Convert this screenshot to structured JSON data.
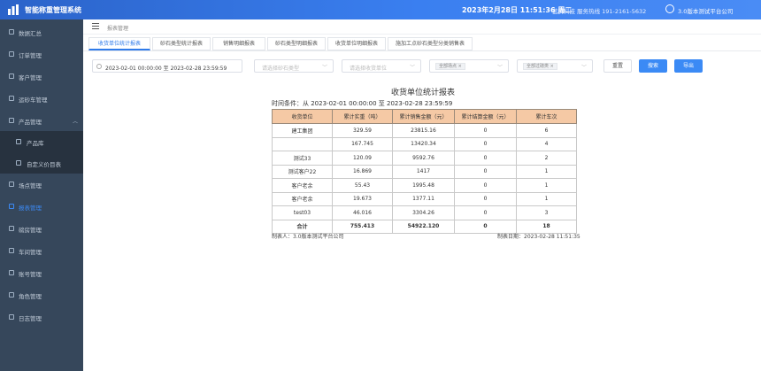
{
  "header": {
    "app_title": "智能称重管理系统",
    "datetime": "2023年2月28日 11:51:36 周二",
    "company_info": "蓝狮科技 服务热线 191-2161-5632",
    "user_label": "3.0版本测试平台公司"
  },
  "sidebar": {
    "items": [
      {
        "label": "数据汇总"
      },
      {
        "label": "订单管理"
      },
      {
        "label": "客户管理"
      },
      {
        "label": "运砂车管理"
      },
      {
        "label": "产品管理"
      },
      {
        "label": "产品库"
      },
      {
        "label": "自定义价目表"
      },
      {
        "label": "场点管理"
      },
      {
        "label": "报表管理"
      },
      {
        "label": "磅房管理"
      },
      {
        "label": "车间管理"
      },
      {
        "label": "账号管理"
      },
      {
        "label": "角色管理"
      },
      {
        "label": "日志管理"
      }
    ]
  },
  "breadcrumb": "报表管理",
  "tabs": [
    {
      "label": "收货单位统计报表"
    },
    {
      "label": "砂石类型统计报表"
    },
    {
      "label": "销售明细报表"
    },
    {
      "label": "砂石类型明细报表"
    },
    {
      "label": "收货单位明细报表"
    },
    {
      "label": "施加工点砂石类型分类销售表"
    }
  ],
  "filters": {
    "date_start": "2023-02-01 00:00:00",
    "date_to": "至",
    "date_end": "2023-02-28 23:59:59",
    "sand_type_placeholder": "请选择砂石类型",
    "receiver_placeholder": "请选择收货单位",
    "tag1": "全部场点",
    "tag2": "全部过磅类",
    "reset_label": "重置",
    "search_label": "搜索",
    "export_label": "导出"
  },
  "report": {
    "title": "收货单位统计报表",
    "time_condition": "时间条件：从 2023-02-01 00:00:00 至 2023-02-28 23:59:59",
    "columns": [
      "收货单位",
      "累计实重（吨）",
      "累计销售金额（元）",
      "累计结算金额（元）",
      "累计车次"
    ],
    "rows": [
      [
        "建工集团",
        "329.59",
        "23815.16",
        "0",
        "6"
      ],
      [
        "",
        "167.745",
        "13420.34",
        "0",
        "4"
      ],
      [
        "测试33",
        "120.09",
        "9592.76",
        "0",
        "2"
      ],
      [
        "测试客户22",
        "16.869",
        "1417",
        "0",
        "1"
      ],
      [
        "客户老余",
        "55.43",
        "1995.48",
        "0",
        "1"
      ],
      [
        "客户老余",
        "19.673",
        "1377.11",
        "0",
        "1"
      ],
      [
        "test03",
        "46.016",
        "3304.26",
        "0",
        "3"
      ]
    ],
    "total": [
      "合计",
      "755.413",
      "54922.120",
      "0",
      "18"
    ],
    "maker": "制表人：3.0版本测试平台公司",
    "made_date": "制表日期：2023-02-28 11:51:35"
  }
}
